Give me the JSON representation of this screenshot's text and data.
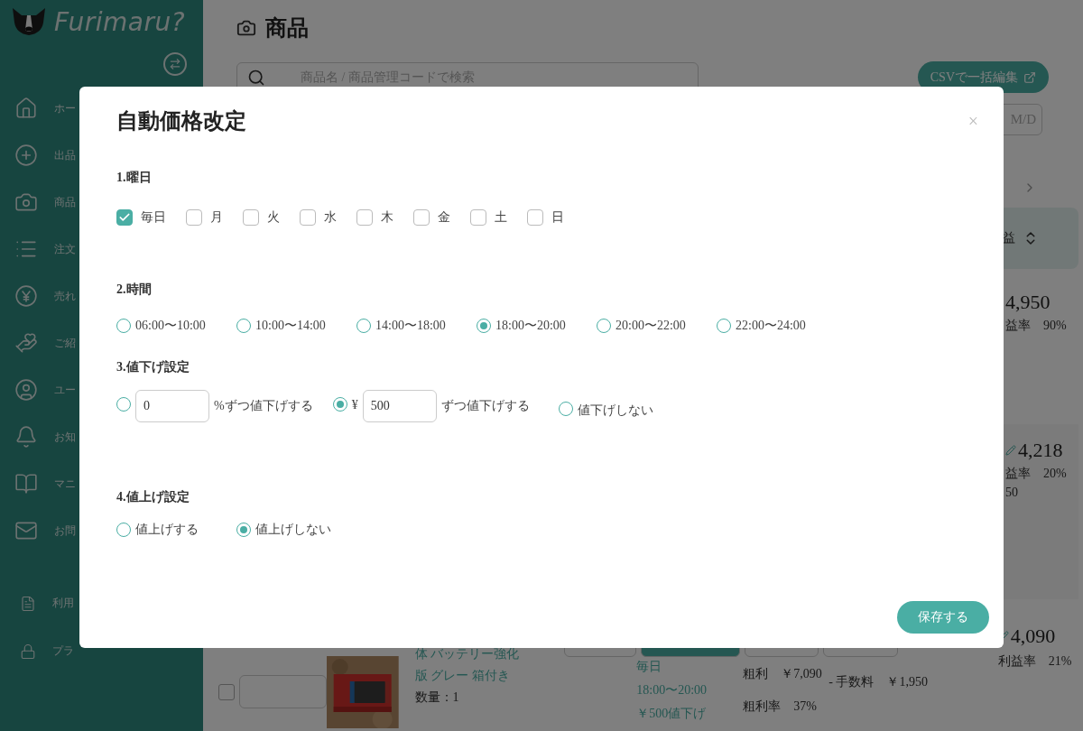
{
  "sidebar": {
    "logo": "Furimaru?",
    "items": [
      {
        "label": "ホー"
      },
      {
        "label": "出品"
      },
      {
        "label": "商品"
      },
      {
        "label": "注文"
      },
      {
        "label": "売れ"
      },
      {
        "label": "ご紹"
      },
      {
        "label": "ユー"
      },
      {
        "label": "お知"
      },
      {
        "label": "マニ"
      },
      {
        "label": "お問"
      }
    ],
    "footer_items": [
      {
        "label": "利用"
      },
      {
        "label": "プラ"
      }
    ]
  },
  "header": {
    "title": "商品"
  },
  "search": {
    "placeholder": "商品名 / 商品管理コードで検索"
  },
  "csv_button": "CSVで一括編集",
  "date_field": {
    "placeholder": "M/D"
  },
  "sort_header": "益",
  "products": [
    {
      "price": "4,950",
      "rate": "益率　90%"
    },
    {
      "price": "4,218",
      "rate": "益率　20%",
      "note": "50"
    }
  ],
  "last_product": {
    "checked": false,
    "name_lines": [
      "体 バッテリー強化",
      "版 グレー 箱付き"
    ],
    "quantity": "数量：1",
    "schedule": [
      "毎日",
      "18:00〜20:00",
      "￥500値下げ"
    ],
    "gross": "粗利　￥7,090",
    "gross_rate": "粗利率　37%",
    "fee": "- 手数料　￥1,950",
    "price": "4,090",
    "rate": "利益率　21%"
  },
  "modal": {
    "title": "自動価格改定",
    "close": "×",
    "weekdays": {
      "heading": "1.曜日",
      "options": [
        {
          "label": "毎日",
          "checked": true
        },
        {
          "label": "月",
          "checked": false
        },
        {
          "label": "火",
          "checked": false
        },
        {
          "label": "水",
          "checked": false
        },
        {
          "label": "木",
          "checked": false
        },
        {
          "label": "金",
          "checked": false
        },
        {
          "label": "土",
          "checked": false
        },
        {
          "label": "日",
          "checked": false
        }
      ]
    },
    "time": {
      "heading": "2.時間",
      "options": [
        {
          "label": "06:00〜10:00",
          "selected": false
        },
        {
          "label": "10:00〜14:00",
          "selected": false
        },
        {
          "label": "14:00〜18:00",
          "selected": false
        },
        {
          "label": "18:00〜20:00",
          "selected": true
        },
        {
          "label": "20:00〜22:00",
          "selected": false
        },
        {
          "label": "22:00〜24:00",
          "selected": false
        }
      ]
    },
    "price_down": {
      "heading": "3.値下げ設定",
      "options": [
        {
          "kind": "percent",
          "value": "0",
          "suffix": "%ずつ値下げする",
          "selected": false
        },
        {
          "kind": "yen",
          "prefix": "¥",
          "value": "500",
          "suffix": "ずつ値下げする",
          "selected": true
        },
        {
          "kind": "none",
          "label": "値下げしない",
          "selected": false
        }
      ]
    },
    "price_up": {
      "heading": "4.値上げ設定",
      "options": [
        {
          "label": "値上げする",
          "selected": false
        },
        {
          "label": "値上げしない",
          "selected": true
        }
      ]
    },
    "save_button": "保存する"
  }
}
